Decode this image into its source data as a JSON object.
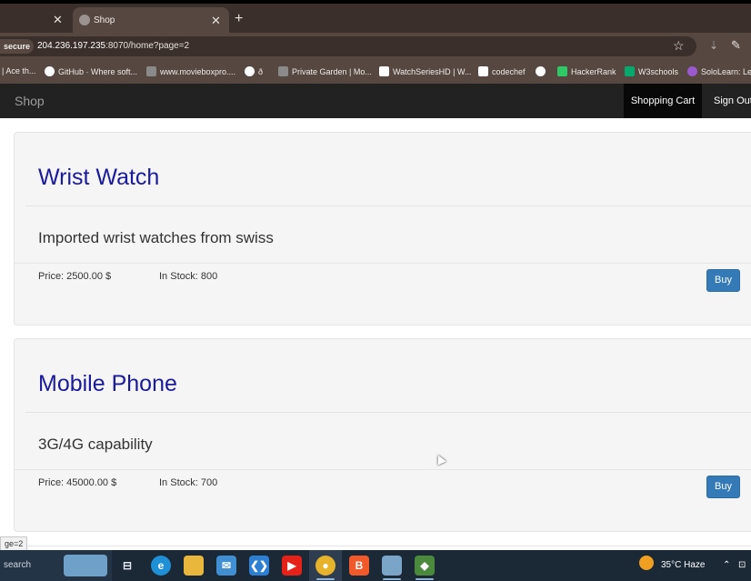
{
  "browser": {
    "prev_tab_close": "✕",
    "active_tab_title": "Shop",
    "active_tab_close": "✕",
    "new_tab": "+",
    "security_badge": "secure",
    "url_host": "204.236.197.235",
    "url_rest": ":8070/home?page=2",
    "bookmarks": [
      {
        "label": "| Ace th...",
        "icon_color": ""
      },
      {
        "label": "GitHub · Where soft...",
        "icon_color": "#ffffff"
      },
      {
        "label": "www.movieboxpro....",
        "icon_color": "#8a8a8a"
      },
      {
        "label": "ð",
        "icon_color": "#ffffff"
      },
      {
        "label": "Private Garden | Mo...",
        "icon_color": "#8a8a8a"
      },
      {
        "label": "WatchSeriesHD | W...",
        "icon_color": "#ffffff"
      },
      {
        "label": "codechef",
        "icon_color": "#ffffff"
      },
      {
        "label": "",
        "icon_color": "#ffffff"
      },
      {
        "label": "HackerRank",
        "icon_color": "#2ec866"
      },
      {
        "label": "W3schools",
        "icon_color": "#04aa6d"
      },
      {
        "label": "SoloLearn: Lea",
        "icon_color": "#9b59d0"
      }
    ]
  },
  "navbar": {
    "brand": "Shop",
    "cart": "Shopping Cart",
    "signout": "Sign Out"
  },
  "products": [
    {
      "name": "Wrist Watch",
      "description": "Imported wrist watches from swiss",
      "price": "Price: 2500.00 $",
      "stock": "In Stock: 800",
      "buy": "Buy"
    },
    {
      "name": "Mobile Phone",
      "description": "3G/4G capability",
      "price": "Price: 45000.00 $",
      "stock": "In Stock: 700",
      "buy": "Buy"
    }
  ],
  "status_link": "ge=2",
  "taskbar": {
    "search_label": "search",
    "weather": "35°C  Haze"
  },
  "colors": {
    "brand_link": "#1a1a9c",
    "buy_button": "#337ab7",
    "navbar": "#222222"
  }
}
